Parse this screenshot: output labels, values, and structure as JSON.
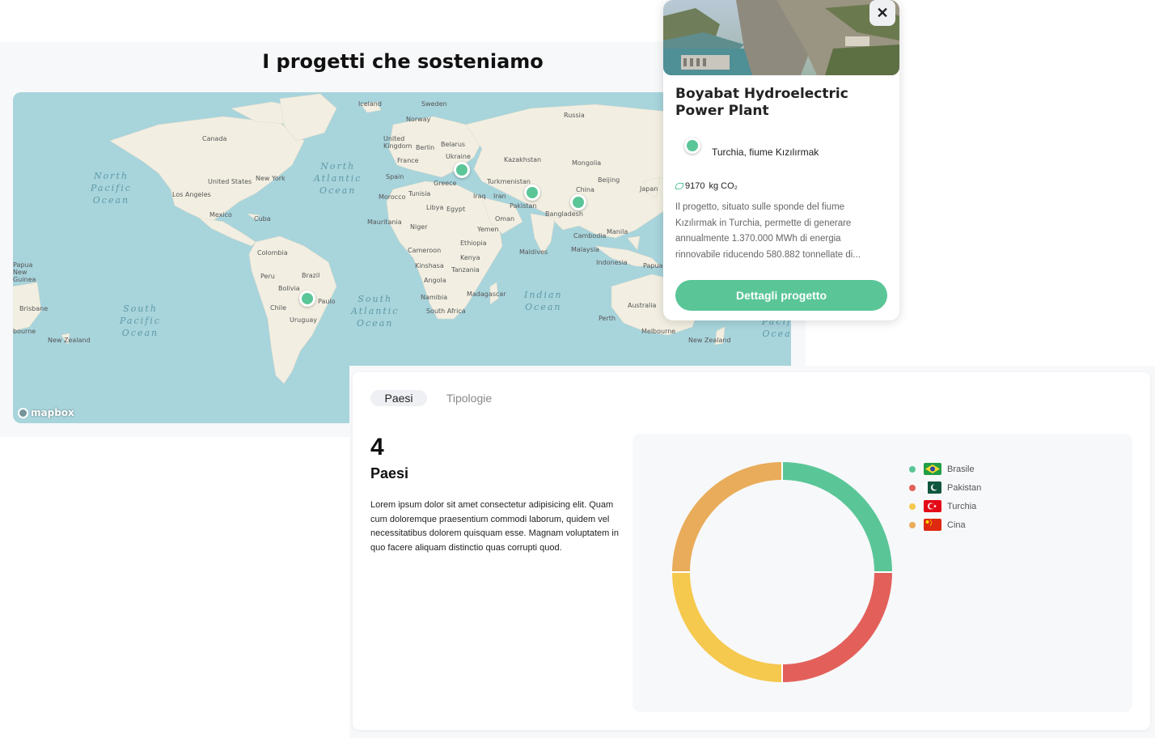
{
  "map_section": {
    "title": "I progetti che sosteniamo",
    "attribution": "mapbox",
    "country_labels": [
      {
        "text": "Iceland"
      },
      {
        "text": "Sweden"
      },
      {
        "text": "Norway"
      },
      {
        "text": "Russia"
      },
      {
        "text": "United Kingdom"
      },
      {
        "text": "Berlin"
      },
      {
        "text": "Belarus"
      },
      {
        "text": "Ukraine"
      },
      {
        "text": "Kazakhstan"
      },
      {
        "text": "Mongolia"
      },
      {
        "text": "France"
      },
      {
        "text": "Spain"
      },
      {
        "text": "Greece"
      },
      {
        "text": "Turkmenistan"
      },
      {
        "text": "Beijing"
      },
      {
        "text": "China"
      },
      {
        "text": "Japan"
      },
      {
        "text": "Morocco"
      },
      {
        "text": "Tunisia"
      },
      {
        "text": "Iraq"
      },
      {
        "text": "Iran"
      },
      {
        "text": "Pakistan"
      },
      {
        "text": "Libya"
      },
      {
        "text": "Egypt"
      },
      {
        "text": "Oman"
      },
      {
        "text": "Bangladesh"
      },
      {
        "text": "Mauritania"
      },
      {
        "text": "Niger"
      },
      {
        "text": "Yemen"
      },
      {
        "text": "Ethiopia"
      },
      {
        "text": "Cambodia"
      },
      {
        "text": "Manila"
      },
      {
        "text": "Cameroon"
      },
      {
        "text": "Kenya"
      },
      {
        "text": "Maldives"
      },
      {
        "text": "Malaysia"
      },
      {
        "text": "Kinshasa"
      },
      {
        "text": "Tanzania"
      },
      {
        "text": "Indonesia"
      },
      {
        "text": "Papua"
      },
      {
        "text": "Angola"
      },
      {
        "text": "Namibia"
      },
      {
        "text": "Madagascar"
      },
      {
        "text": "South Africa"
      },
      {
        "text": "Australia"
      },
      {
        "text": "Perth"
      },
      {
        "text": "Melbourne"
      },
      {
        "text": "New Zealand"
      },
      {
        "text": "Canada"
      },
      {
        "text": "United States"
      },
      {
        "text": "New York"
      },
      {
        "text": "Los Angeles"
      },
      {
        "text": "Mexico"
      },
      {
        "text": "Cuba"
      },
      {
        "text": "Colombia"
      },
      {
        "text": "Peru"
      },
      {
        "text": "Brazil"
      },
      {
        "text": "Bolivia"
      },
      {
        "text": "Chile"
      },
      {
        "text": "Paulo"
      },
      {
        "text": "Uruguay"
      },
      {
        "text": "Papua New Guinea"
      },
      {
        "text": "Brisbane"
      },
      {
        "text": "bourne"
      },
      {
        "text": "New Zealand"
      }
    ],
    "ocean_labels": [
      {
        "text": "North\nPacific\nOcean"
      },
      {
        "text": "North\nAtlantic\nOcean"
      },
      {
        "text": "South\nPacific\nOcean"
      },
      {
        "text": "South\nAtlantic\nOcean"
      },
      {
        "text": "Indian\nOcean"
      },
      {
        "text": "Pacif\nOcea"
      }
    ],
    "pin_color": "#5ac698"
  },
  "popup": {
    "title": "Boyabat Hydroelectric Power Plant",
    "location": "Turchia, fiume Kızılırmak",
    "co2_value": "9170",
    "co2_unit": "kg CO₂",
    "description": "Il progetto, situato sulle sponde del fiume Kızılırmak in Turchia, permette di generare annualmente 1.370.000 MWh di energia rinnovabile riducendo 580.882 tonnellate di...",
    "button_label": "Dettagli progetto",
    "close_icon": "close-icon"
  },
  "stats": {
    "tabs": [
      {
        "label": "Paesi",
        "active": true
      },
      {
        "label": "Tipologie",
        "active": false
      }
    ],
    "count": "4",
    "count_label": "Paesi",
    "description": "Lorem ipsum dolor sit amet consectetur adipisicing elit. Quam cum doloremque praesentium commodi laborum, quidem vel necessitatibus dolorem quisquam esse. Magnam voluptatem in quo facere aliquam distinctio quas corrupti quod."
  },
  "chart_data": {
    "type": "pie",
    "variant": "doughnut",
    "categories": [
      "Brasile",
      "Pakistan",
      "Turchia",
      "Cina"
    ],
    "values": [
      25,
      25,
      25,
      25
    ],
    "colors": [
      "#5ac698",
      "#e3605a",
      "#f5c84e",
      "#e9ac5a"
    ],
    "legend_position": "right"
  }
}
